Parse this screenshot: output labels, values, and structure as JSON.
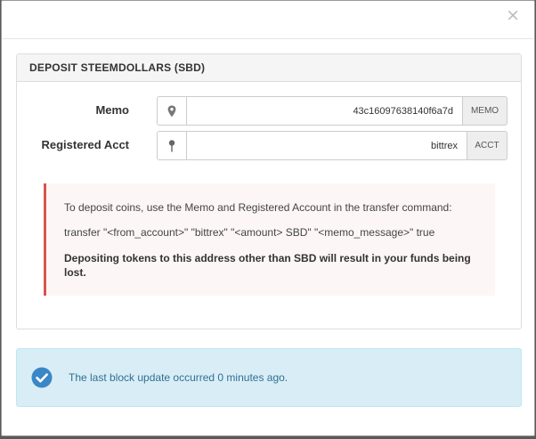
{
  "modal": {
    "close_glyph": "×"
  },
  "panel": {
    "title": "DEPOSIT STEEMDOLLARS (SBD)"
  },
  "memo": {
    "label": "Memo",
    "value": "43c16097638140f6a7d",
    "addon": "MEMO",
    "icon": "map-marker-icon"
  },
  "account": {
    "label": "Registered Acct",
    "value": "bittrex",
    "addon": "ACCT",
    "icon": "pushpin-icon"
  },
  "warning": {
    "instructions": "To deposit coins, use the Memo and Registered Account in the transfer command:",
    "command": "transfer \"<from_account>\" \"bittrex\" \"<amount> SBD\" \"<memo_message>\" true",
    "danger_text": "Depositing tokens to this address other than SBD will result in your funds being lost.",
    "accent_color": "#d9534f"
  },
  "status": {
    "message": "The last block update occurred 0 minutes ago.",
    "icon": "check-circle-icon",
    "accent_color": "#3a87c8"
  }
}
